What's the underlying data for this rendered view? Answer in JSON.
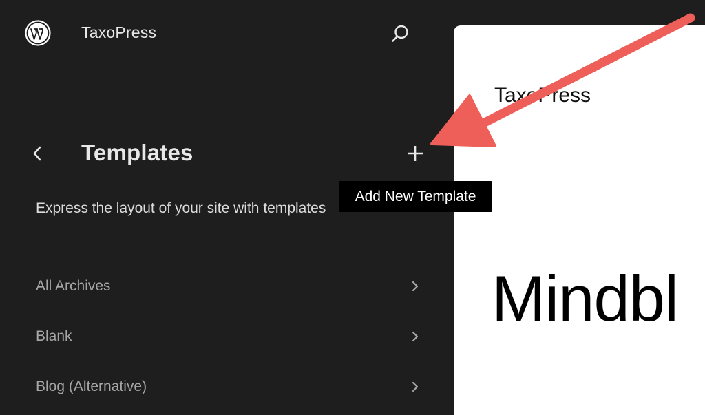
{
  "header": {
    "logo_icon": "wordpress-logo-icon",
    "site_title": "TaxoPress",
    "search_icon": "search-icon"
  },
  "panel": {
    "back_icon": "chevron-left-icon",
    "title": "Templates",
    "add_icon": "plus-icon",
    "add_tooltip": "Add New Template",
    "description": "Express the layout of your site with templates"
  },
  "templates": [
    {
      "label": "All Archives",
      "icon": "chevron-right-icon"
    },
    {
      "label": "Blank",
      "icon": "chevron-right-icon"
    },
    {
      "label": "Blog (Alternative)",
      "icon": "chevron-right-icon"
    }
  ],
  "preview": {
    "site_title": "TaxoPress",
    "heading": "Mindbl"
  },
  "colors": {
    "sidebar_bg": "#1e1e1e",
    "text_primary": "#e8e8e8",
    "text_muted": "#a7a7a7",
    "tooltip_bg": "#000000",
    "canvas_bg": "#ffffff",
    "annotation_arrow": "#ef5f5a"
  }
}
